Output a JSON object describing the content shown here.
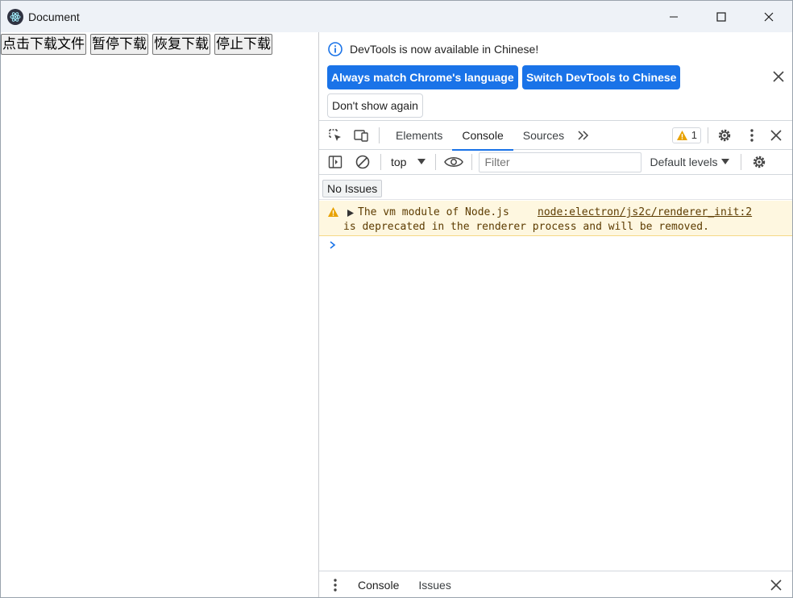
{
  "window": {
    "title": "Document"
  },
  "page": {
    "buttons": [
      "点击下载文件",
      "暂停下载",
      "恢复下载",
      "停止下载"
    ]
  },
  "devtools": {
    "infobar": {
      "message": "DevTools is now available in Chinese!",
      "match_language": "Always match Chrome's language",
      "switch_language": "Switch DevTools to Chinese",
      "dont_show": "Don't show again"
    },
    "tabs": [
      "Elements",
      "Console",
      "Sources"
    ],
    "active_tab": "Console",
    "warning_count": "1",
    "toolbar": {
      "context": "top",
      "filter_placeholder": "Filter",
      "levels": "Default levels"
    },
    "issues_button": "No Issues",
    "console_messages": [
      {
        "level": "warning",
        "line1": "The vm module of Node.js",
        "line2": "is deprecated in the renderer process and will be removed.",
        "source": "node:electron/js2c/renderer_init:2"
      }
    ],
    "drawer_tabs": [
      "Console",
      "Issues"
    ],
    "colors": {
      "accent": "#1a73e8",
      "warning_bg": "#fef7e0"
    }
  }
}
